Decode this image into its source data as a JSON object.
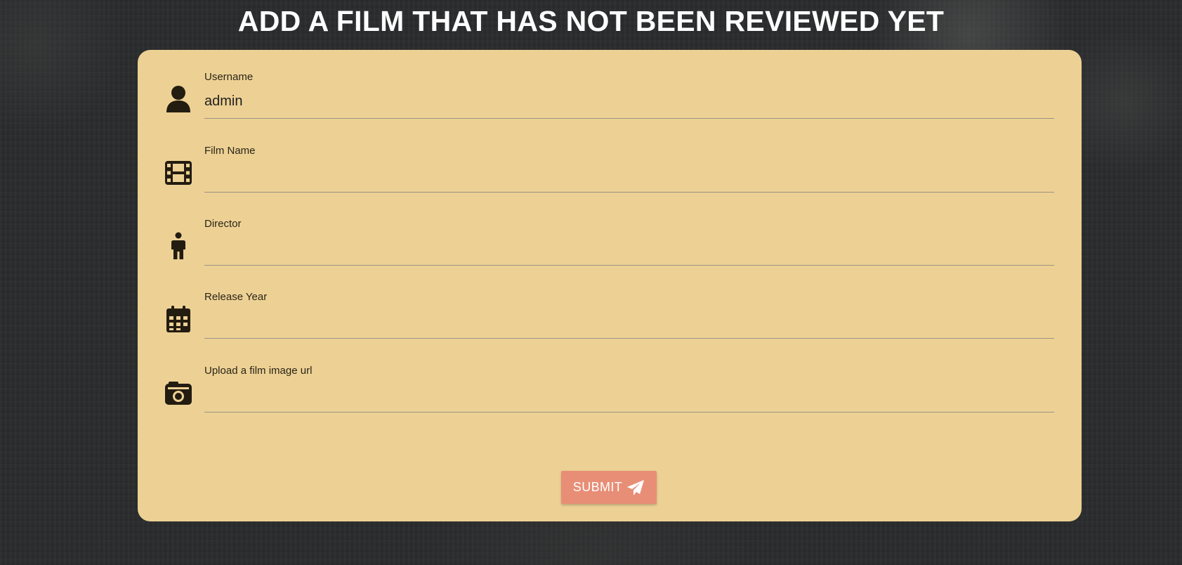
{
  "page": {
    "title": "ADD A FILM THAT HAS NOT BEEN REVIEWED YET"
  },
  "form": {
    "fields": [
      {
        "label": "Username",
        "value": "admin",
        "icon": "user-icon"
      },
      {
        "label": "Film Name",
        "value": "",
        "icon": "film-icon"
      },
      {
        "label": "Director",
        "value": "",
        "icon": "person-standing-icon"
      },
      {
        "label": "Release Year",
        "value": "",
        "icon": "calendar-icon"
      },
      {
        "label": "Upload a film image url",
        "value": "",
        "icon": "camera-icon"
      }
    ],
    "submit_label": "SUBMIT",
    "submit_icon": "paper-plane-icon"
  },
  "colors": {
    "card_background": "#edd194",
    "submit_button": "#e88e77",
    "page_background": "#2b2c2d",
    "title_text": "#ffffff",
    "icon": "#231c10"
  }
}
